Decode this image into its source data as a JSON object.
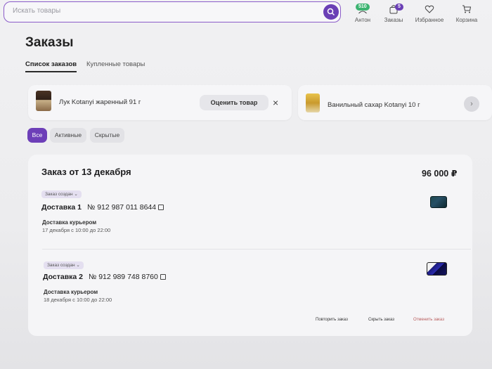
{
  "header": {
    "search_placeholder": "Искать товары",
    "profile": {
      "badge": "510",
      "label": "Антон",
      "badge_color": "#3cb371"
    },
    "orders": {
      "badge": "5",
      "label": "Заказы",
      "badge_color": "#6a3fb5"
    },
    "favorites": {
      "label": "Избранное"
    },
    "cart": {
      "label": "Корзина"
    }
  },
  "page": {
    "title": "Заказы",
    "tabs": [
      {
        "label": "Список заказов",
        "active": true
      },
      {
        "label": "Купленные товары",
        "active": false
      }
    ]
  },
  "rate_strip": {
    "items": [
      {
        "name": "Лук Kotanyi жаренный 91 г",
        "button": "Оценить товар",
        "close": "×"
      },
      {
        "name": "Ванильный сахар Kotanyi 10 г"
      }
    ],
    "next": "›"
  },
  "filters": [
    {
      "label": "Все",
      "active": true
    },
    {
      "label": "Активные",
      "active": false
    },
    {
      "label": "Скрытые",
      "active": false
    }
  ],
  "order": {
    "title": "Заказ от 13 декабря",
    "sum": "96 000 ₽",
    "deliveries": [
      {
        "status": "Заказ создан",
        "title": "Доставка 1",
        "number": "№ 912 987 011 8644",
        "type": "Доставка курьером",
        "time": "17 декабря с 10:00 до 22:00"
      },
      {
        "status": "Заказ создан",
        "title": "Доставка 2",
        "number": "№ 912 989 748 8760",
        "type": "Доставка курьером",
        "time": "18 декабря с 10:00 до 22:00"
      }
    ],
    "actions": {
      "repeat": "Повторить заказ",
      "hide": "Скрыть заказ",
      "cancel": "Отменить заказ"
    }
  },
  "colors": {
    "accent": "#6a3fb5",
    "cancel": "#b85c5c"
  }
}
